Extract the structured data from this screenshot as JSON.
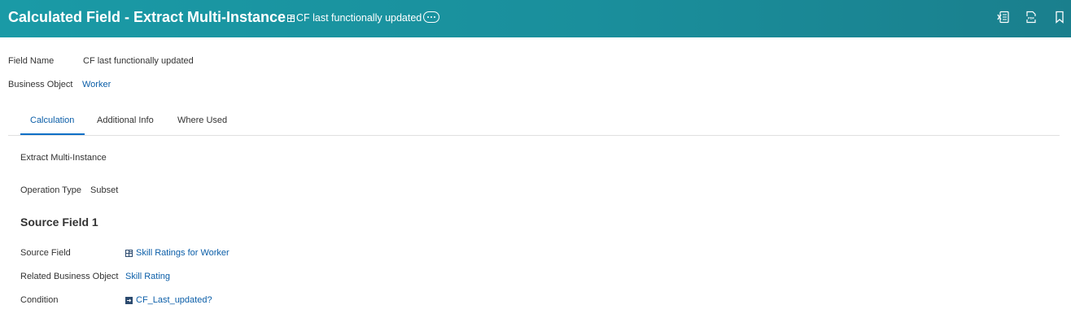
{
  "header": {
    "title": "Calculated Field - Extract Multi-Instance",
    "instance_label": "CF last functionally updated",
    "instance_icon": "related-actions-icon",
    "actions": [
      "export-excel-icon",
      "export-pdf-icon",
      "bookmark-icon"
    ],
    "accent_color": "#1a8f9c"
  },
  "details": {
    "field_name_label": "Field Name",
    "field_name_value": "CF last functionally updated",
    "business_object_label": "Business Object",
    "business_object_value": "Worker"
  },
  "tabs": [
    {
      "label": "Calculation",
      "active": true
    },
    {
      "label": "Additional Info",
      "active": false
    },
    {
      "label": "Where Used",
      "active": false
    }
  ],
  "calculation": {
    "type_text": "Extract Multi-Instance",
    "operation_type_label": "Operation Type",
    "operation_type_value": "Subset",
    "section_title": "Source Field 1",
    "source_field_label": "Source Field",
    "source_field_value": "Skill Ratings for Worker",
    "related_bo_label": "Related Business Object",
    "related_bo_value": "Skill Rating",
    "condition_label": "Condition",
    "condition_value": "CF_Last_updated?"
  },
  "colors": {
    "link": "#0b5ea8",
    "tab_active_underline": "#0b6fc6"
  }
}
